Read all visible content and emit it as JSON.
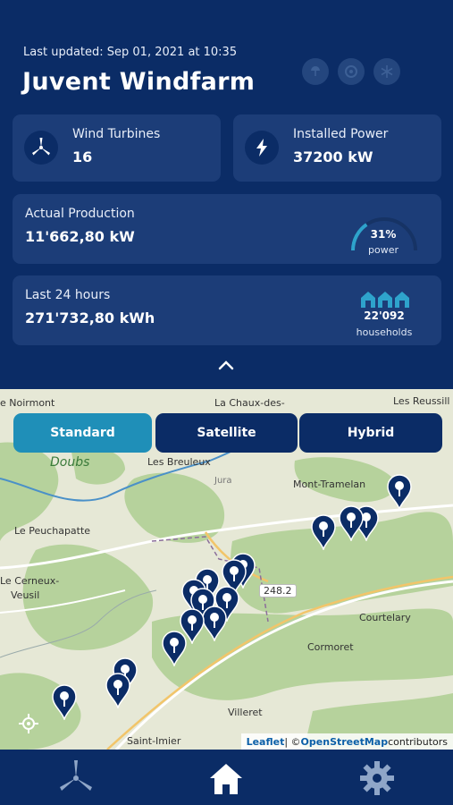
{
  "header": {
    "last_updated": "Last updated: Sep 01, 2021 at 10:35",
    "title": "Juvent Windfarm"
  },
  "weather_buttons": [
    "weather-icon",
    "vortex-icon",
    "snowflake-icon"
  ],
  "cards": {
    "turbines": {
      "label": "Wind Turbines",
      "value": "16"
    },
    "power": {
      "label": "Installed Power",
      "value": "37200 kW"
    },
    "production": {
      "label": "Actual Production",
      "value": "11'662,80 kW",
      "gauge_percent": "31%",
      "gauge_caption": "power",
      "gauge_fraction": 0.31
    },
    "last24": {
      "label": "Last 24 hours",
      "value": "271'732,80 kWh",
      "households": "22'092",
      "households_caption": "households"
    }
  },
  "map": {
    "tabs": [
      "Standard",
      "Satellite",
      "Hybrid"
    ],
    "active_tab": "Standard",
    "places": [
      "e Noirmont",
      "La Chaux-des-",
      "Les Reussill",
      "Doubs",
      "Les Breuleux",
      "Jura",
      "Mont-Tramelan",
      "Le Peuchapatte",
      "Le Cerneux-",
      "Veusil",
      "248.2",
      "Courtelary",
      "Cormoret",
      "Villeret",
      "Saint-Imier"
    ],
    "attribution": {
      "leaflet": "Leaflet",
      "sep": " | © ",
      "osm": "OpenStreetMap",
      "contributors": " contributors"
    }
  },
  "nav": [
    "turbine-icon",
    "home-icon",
    "settings-icon"
  ],
  "colors": {
    "background": "#0b2c66",
    "card": "#1c3d78",
    "accent": "#1f8fb8",
    "gauge": "#2ea3cc"
  }
}
